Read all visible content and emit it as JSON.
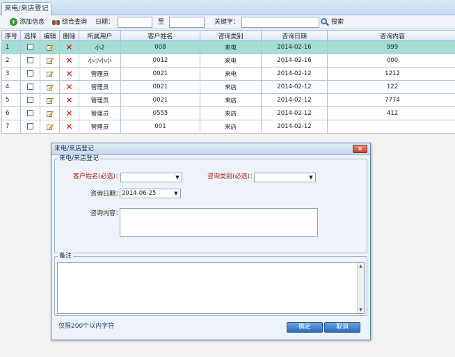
{
  "tab": {
    "label": "来电/来店登记"
  },
  "toolbar": {
    "add_label": "添加信息",
    "query_label": "综合查询",
    "date_label": "日期：",
    "to_label": "至",
    "keyword_label": "关键字：",
    "search_label": "搜索",
    "date_from_value": "",
    "date_to_value": "",
    "keyword_value": ""
  },
  "grid": {
    "headers": [
      "序号",
      "选择",
      "编辑",
      "删除",
      "所属用户",
      "客户姓名",
      "咨询类别",
      "咨询日期",
      "咨询内容"
    ],
    "rows": [
      {
        "no": "1",
        "user": "小2",
        "customer": "008",
        "category": "来电",
        "date": "2014-02-16",
        "content": "999"
      },
      {
        "no": "2",
        "user": "小小小小",
        "customer": "0012",
        "category": "来电",
        "date": "2014-02-16",
        "content": "000"
      },
      {
        "no": "3",
        "user": "管理员",
        "customer": "0021",
        "category": "来电",
        "date": "2014-02-12",
        "content": "1212"
      },
      {
        "no": "4",
        "user": "管理员",
        "customer": "0021",
        "category": "来店",
        "date": "2014-02-12",
        "content": "122"
      },
      {
        "no": "5",
        "user": "管理员",
        "customer": "0021",
        "category": "来店",
        "date": "2014-02-12",
        "content": "7774"
      },
      {
        "no": "6",
        "user": "管理员",
        "customer": "0555",
        "category": "来店",
        "date": "2014-02-12",
        "content": "412"
      },
      {
        "no": "7",
        "user": "管理员",
        "customer": "001",
        "category": "来店",
        "date": "2014-02-12",
        "content": ""
      }
    ],
    "selected_row": 1
  },
  "dialog": {
    "title": "来电/来店登记",
    "close_label": "×",
    "group_legend": "来电/来店登记",
    "customer_label": "客户姓名(必选)：",
    "customer_value": "",
    "category_label": "咨询类别(必选)：",
    "category_value": "",
    "date_label": "咨询日期：",
    "date_value": "2014-06-25",
    "content_label": "咨询内容：",
    "remark_legend": "备注",
    "hint": "仅限200个以内字符",
    "confirm_label": "确定",
    "cancel_label": "取消"
  },
  "icons": {
    "add": "plus-circle-icon",
    "query": "binoculars-icon",
    "search": "magnifier-icon",
    "edit": "edit-pencil-icon",
    "delete": "red-x-icon",
    "checkbox": "checkbox-icon"
  },
  "colors": {
    "selected_row": "#a4ddd6",
    "required_label": "#a51f1f",
    "button": "#2c6cbd"
  }
}
